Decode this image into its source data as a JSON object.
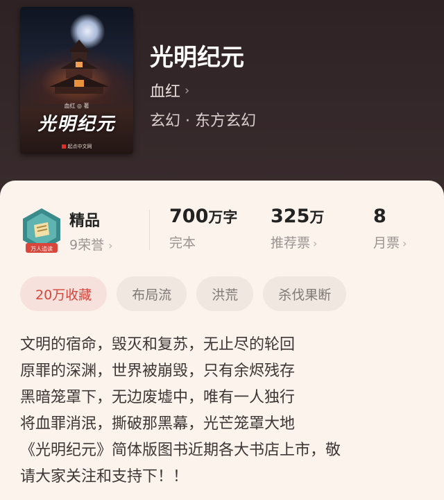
{
  "book": {
    "title": "光明纪元",
    "author": "血红",
    "genre": "玄幻 · 东方玄幻",
    "cover": {
      "title": "光明纪元",
      "author_line": "血红 ◎ 著",
      "publisher": "起点中文网"
    }
  },
  "quality": {
    "badge_text": "万人追读",
    "title": "精品",
    "honor": "9荣誉"
  },
  "stats": [
    {
      "value": "700",
      "unit": "万字",
      "label": "完本",
      "has_chevron": false
    },
    {
      "value": "325",
      "unit": "万",
      "label": "推荐票",
      "has_chevron": true
    },
    {
      "value": "8",
      "unit": "",
      "label": "月票",
      "has_chevron": true
    }
  ],
  "tags": [
    "20万收藏",
    "布局流",
    "洪荒",
    "杀伐果断"
  ],
  "description": [
    "文明的宿命，毁灭和复苏，无止尽的轮回",
    "原罪的深渊，世界被崩毁，只有余烬残存",
    "黑暗笼罩下，无边废墟中，唯有一人独行",
    "将血罪消泯，撕破那黑幕，光芒笼罩大地",
    "《光明纪元》简体版图书近期各大书店上市，敬",
    "请大家关注和支持下！！"
  ],
  "icons": {
    "chevron": "chevron-right-icon"
  },
  "colors": {
    "accent_red": "#d4453b",
    "header_bg": "#2e2224",
    "card_bg": "#fbf3ec"
  }
}
